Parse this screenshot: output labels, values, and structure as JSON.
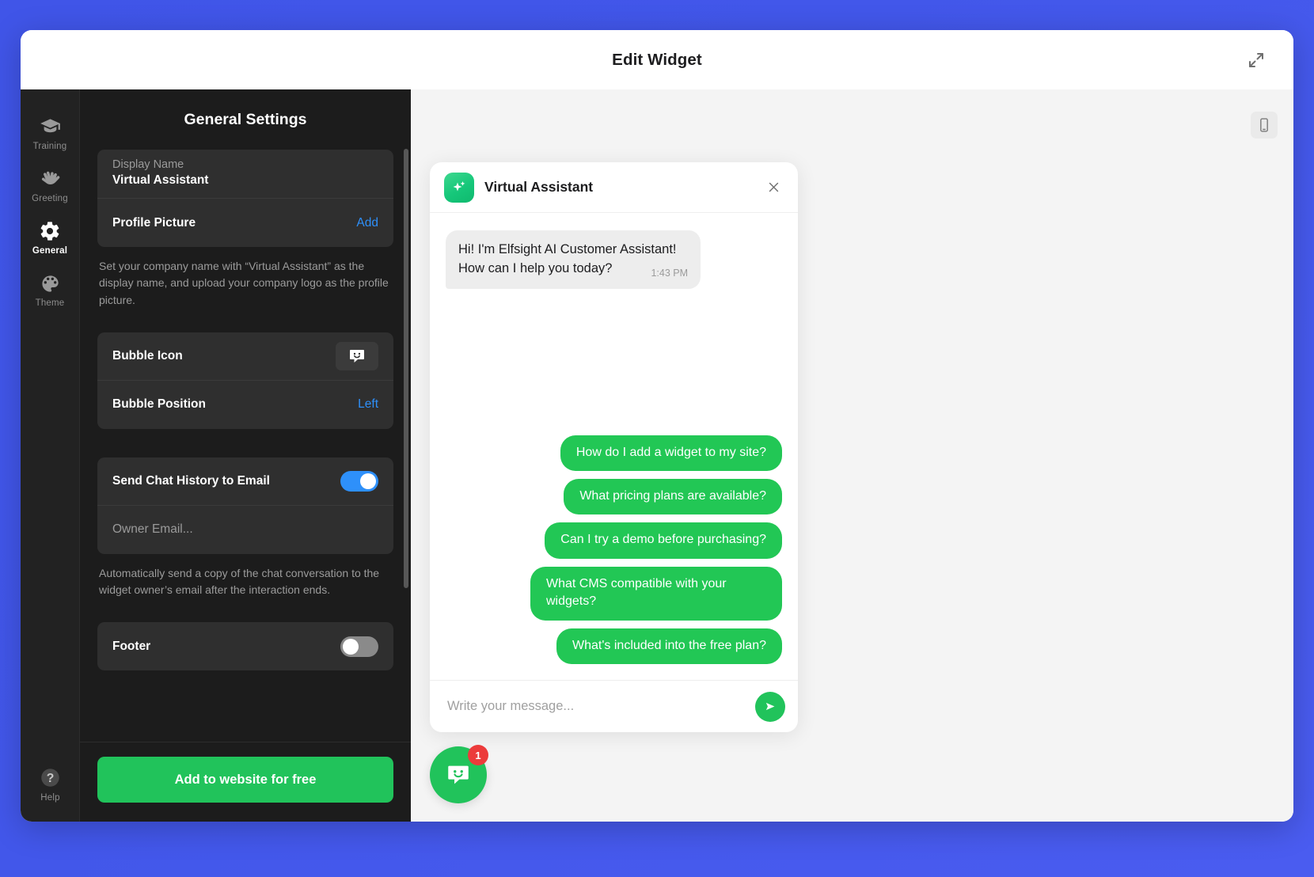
{
  "window": {
    "title": "Edit Widget",
    "expand_icon": "expand-diagonal-icon"
  },
  "rail": {
    "items": [
      {
        "label": "Training",
        "icon": "graduation-cap-icon",
        "active": false
      },
      {
        "label": "Greeting",
        "icon": "waving-hand-icon",
        "active": false
      },
      {
        "label": "General",
        "icon": "gear-icon",
        "active": true
      },
      {
        "label": "Theme",
        "icon": "palette-icon",
        "active": false
      }
    ],
    "help": {
      "label": "Help",
      "icon": "question-mark-icon"
    }
  },
  "settings": {
    "title": "General Settings",
    "display_name": {
      "label": "Display Name",
      "value": "Virtual Assistant"
    },
    "profile_picture": {
      "label": "Profile Picture",
      "action": "Add"
    },
    "identity_help": "Set your company name with “Virtual Assistant” as the display name, and upload your company logo as the profile picture.",
    "bubble_icon": {
      "label": "Bubble Icon",
      "icon": "chat-smiley-icon"
    },
    "bubble_position": {
      "label": "Bubble Position",
      "value": "Left"
    },
    "send_chat_history": {
      "label": "Send Chat History to Email",
      "state": "on"
    },
    "owner_email": {
      "placeholder": "Owner Email..."
    },
    "email_help": "Automatically send a copy of the chat conversation to the widget owner’s email after the interaction ends.",
    "footer": {
      "label": "Footer",
      "state": "off"
    },
    "cta": "Add to website for free"
  },
  "preview": {
    "device_toggle_icon": "mobile-phone-icon",
    "widget": {
      "header": {
        "name": "Virtual Assistant",
        "avatar_icon": "sparkle-icon",
        "close_icon": "close-x-icon"
      },
      "messages": [
        {
          "from": "bot",
          "text": "Hi! I'm Elfsight AI Customer Assistant! How can I help you today?",
          "time": "1:43 PM"
        }
      ],
      "suggestions": [
        "How do I add a widget to my site?",
        "What pricing plans are available?",
        "Can I try a demo before purchasing?",
        "What CMS compatible with your widgets?",
        "What's included into the free plan?"
      ],
      "input": {
        "placeholder": "Write your message...",
        "value": "",
        "send_icon": "send-paper-plane-icon"
      }
    },
    "launcher": {
      "icon": "chat-smiley-icon",
      "badge": "1"
    }
  },
  "colors": {
    "background": "#4055e8",
    "accent_green": "#21c35b",
    "accent_blue": "#2e90fa",
    "badge_red": "#ec3b3b",
    "panel_dark": "#1c1c1c",
    "rail_dark": "#222222"
  }
}
